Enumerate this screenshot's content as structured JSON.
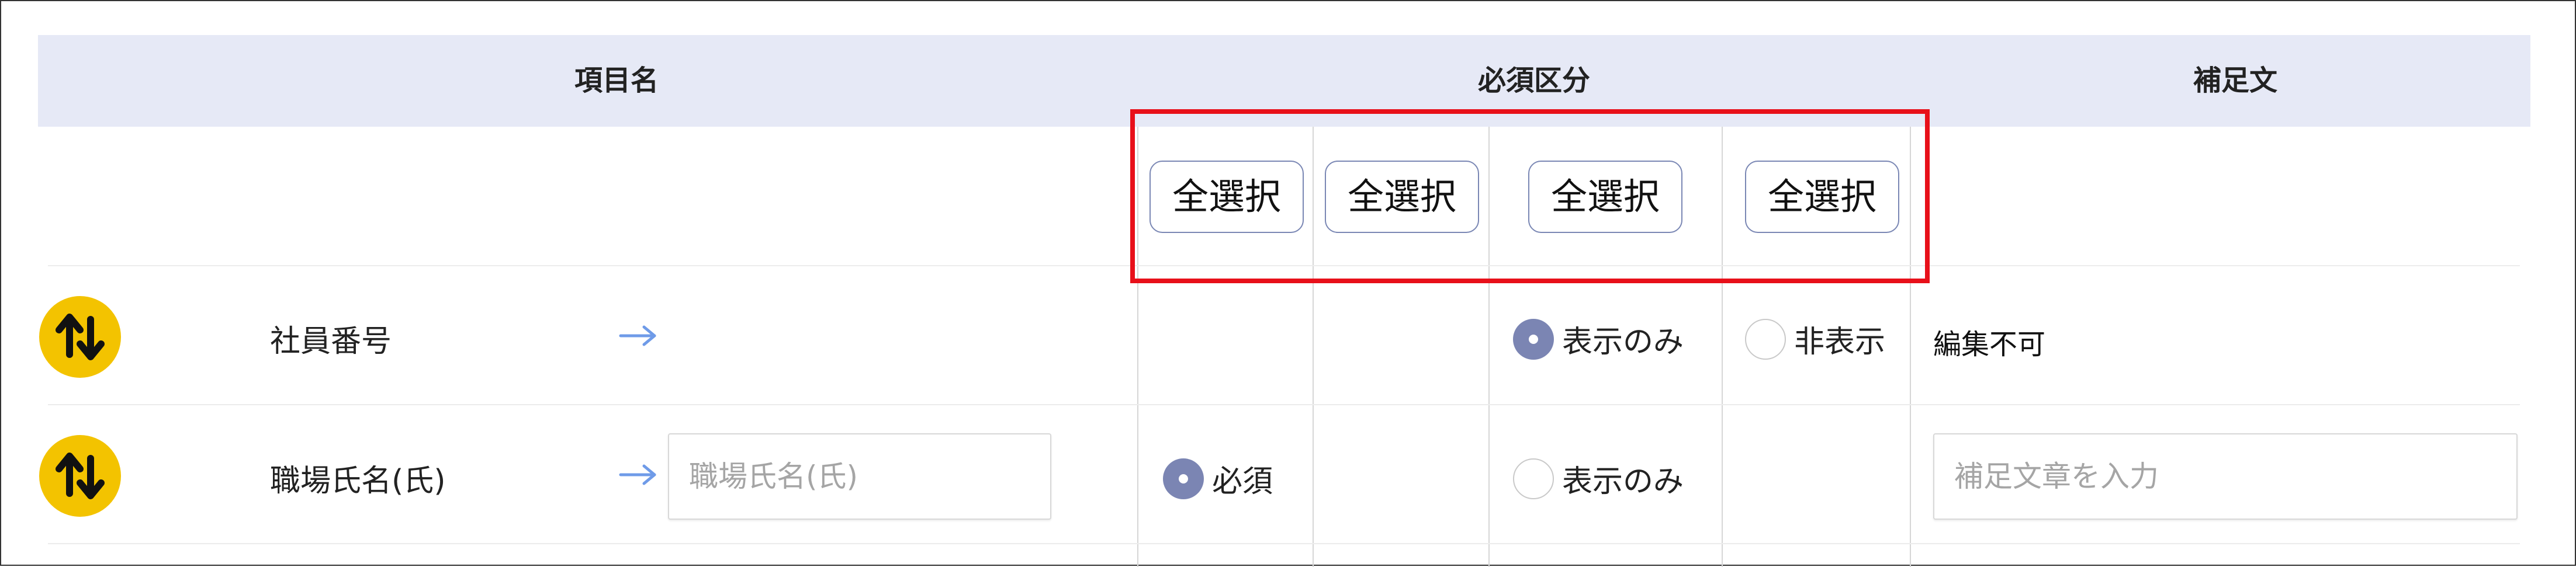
{
  "header": {
    "item_name": "項目名",
    "required_category": "必須区分",
    "supplement": "補足文"
  },
  "select_all_buttons": [
    "全選択",
    "全選択",
    "全選択",
    "全選択"
  ],
  "rows": [
    {
      "label": "社員番号",
      "input_placeholder": "",
      "required_option": "",
      "display_only_option": "表示のみ",
      "display_only_checked": true,
      "hidden_option": "非表示",
      "hidden_checked": false,
      "supplement_text": "編集不可"
    },
    {
      "label": "職場氏名(氏)",
      "input_placeholder": "職場氏名(氏)",
      "required_option": "必須",
      "required_checked": true,
      "display_only_option": "表示のみ",
      "display_only_checked": false,
      "supplement_placeholder": "補足文章を入力"
    }
  ],
  "colors": {
    "header_bg": "#e6e9f6",
    "accent": "#7b85b3",
    "highlight_box": "#e8101a",
    "sort_icon_bg": "#f3c300",
    "arrow": "#6f9be8"
  },
  "icons": {
    "sort": "sort-up-down-icon",
    "arrow": "arrow-right-icon"
  }
}
